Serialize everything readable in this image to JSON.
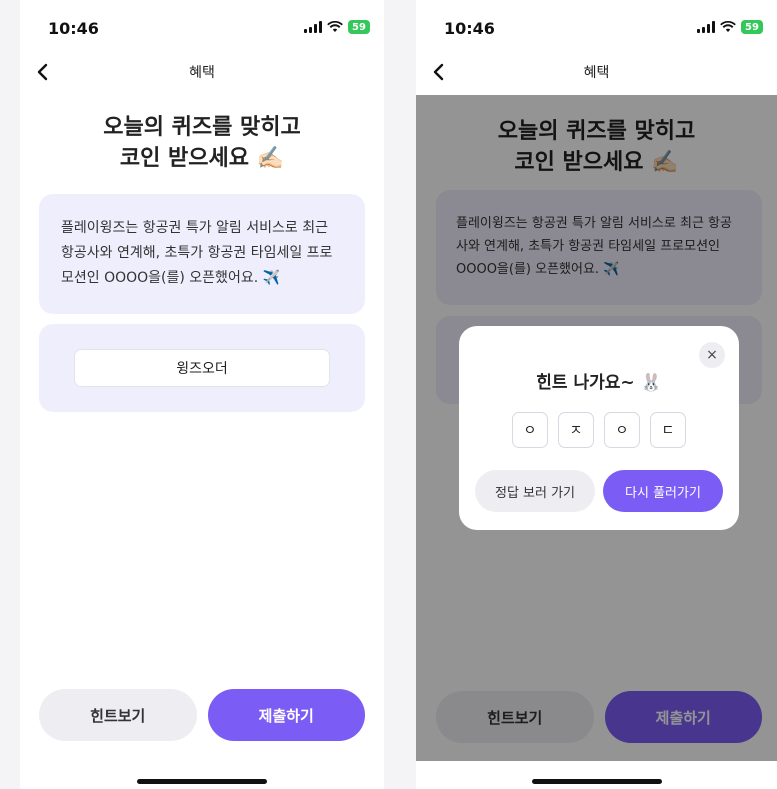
{
  "left": {
    "status": {
      "time": "10:46",
      "battery": "59"
    },
    "nav": {
      "title": "혜택"
    },
    "headline": {
      "line1": "오늘의 퀴즈를 맞히고",
      "line2": "코인 받으세요",
      "emoji": "✍🏻"
    },
    "question": "플레이윙즈는 항공권 특가 알림 서비스로 최근 항공사와 연계해, 초특가 항공권 타임세일 프로모션인 OOOO을(를) 오픈했어요. ✈️",
    "answer_value": "윙즈오더",
    "buttons": {
      "hint": "힌트보기",
      "submit": "제출하기"
    }
  },
  "right": {
    "status": {
      "time": "10:46",
      "battery": "59"
    },
    "nav": {
      "title": "혜택"
    },
    "headline": {
      "line1": "오늘의 퀴즈를 맞히고",
      "line2": "코인 받으세요",
      "emoji": "✍🏻"
    },
    "question": "플레이윙즈는 항공권 특가 알림 서비스로 최근 항공사와 연계해, 초특가 항공권 타임세일 프로모션인 OOOO을(를) 오픈했어요. ✈️",
    "buttons": {
      "hint": "힌트보기",
      "submit": "제출하기"
    },
    "modal": {
      "close": "×",
      "title": "힌트 나가요~ 🐰",
      "hints": [
        "ㅇ",
        "ㅈ",
        "ㅇ",
        "ㄷ"
      ],
      "answer_button": "정답 보러 가기",
      "retry_button": "다시 풀러가기"
    }
  },
  "colors": {
    "accent": "#7b5cf5",
    "card": "#efeefd",
    "battery": "#34c759"
  }
}
